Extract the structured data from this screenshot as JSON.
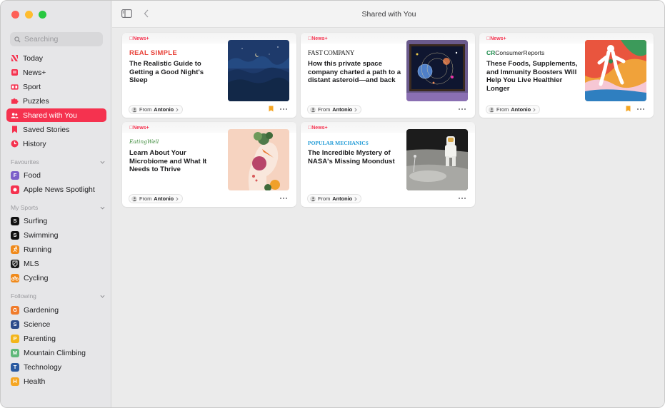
{
  "window": {
    "title": "Shared with You"
  },
  "search": {
    "placeholder": "Searching"
  },
  "nav": [
    {
      "label": "Today",
      "icon": "news-n-icon"
    },
    {
      "label": "News+",
      "icon": "news-plus-icon"
    },
    {
      "label": "Sport",
      "icon": "scoreboard-icon"
    },
    {
      "label": "Puzzles",
      "icon": "puzzle-icon"
    },
    {
      "label": "Shared with You",
      "icon": "people-icon",
      "active": true
    },
    {
      "label": "Saved Stories",
      "icon": "bookmark-icon"
    },
    {
      "label": "History",
      "icon": "clock-icon"
    }
  ],
  "favourites": {
    "header": "Favourites",
    "items": [
      {
        "label": "Food",
        "badge": "F",
        "color": "#7b5fc9"
      },
      {
        "label": "Apple News Spotlight",
        "badge": "",
        "color": "#f5324f"
      }
    ]
  },
  "my_sports": {
    "header": "My Sports",
    "items": [
      {
        "label": "Surfing",
        "badge": "S",
        "color": "#111111"
      },
      {
        "label": "Swimming",
        "badge": "S",
        "color": "#111111"
      },
      {
        "label": "Running",
        "badge": "",
        "color": "#f08a1c"
      },
      {
        "label": "MLS",
        "badge": "",
        "color": "#1a1a1a"
      },
      {
        "label": "Cycling",
        "badge": "",
        "color": "#f08a1c"
      }
    ]
  },
  "following": {
    "header": "Following",
    "items": [
      {
        "label": "Gardening",
        "badge": "G",
        "color": "#f07b2a"
      },
      {
        "label": "Science",
        "badge": "S",
        "color": "#2c4a8a"
      },
      {
        "label": "Parenting",
        "badge": "P",
        "color": "#f3b51b"
      },
      {
        "label": "Mountain Climbing",
        "badge": "M",
        "color": "#5fb87a"
      },
      {
        "label": "Technology",
        "badge": "T",
        "color": "#2a5aa0"
      },
      {
        "label": "Health",
        "badge": "H",
        "color": "#f5a623"
      }
    ]
  },
  "cards": [
    {
      "tag": "News+",
      "publisher": "REAL SIMPLE",
      "headline": "The Realistic Guide to Getting a Good Night's Sleep",
      "from_prefix": "From",
      "from_name": "Antonio",
      "bookmarked": true
    },
    {
      "tag": "News+",
      "publisher": "FAST COMPANY",
      "headline": "How this private space company charted a path to a distant asteroid—and back",
      "from_prefix": "From",
      "from_name": "Antonio",
      "bookmarked": false
    },
    {
      "tag": "News+",
      "publisher": "ConsumerReports",
      "publisher_mark": "CR",
      "headline": "These Foods, Supplements, and Immunity Boosters Will Help You Live Healthier Longer",
      "from_prefix": "From",
      "from_name": "Antonio",
      "bookmarked": true
    },
    {
      "tag": "News+",
      "publisher": "EatingWell",
      "headline": "Learn About Your Microbiome and What It Needs to Thrive",
      "from_prefix": "From",
      "from_name": "Antonio",
      "bookmarked": false
    },
    {
      "tag": "News+",
      "publisher": "POPULAR MECHANICS",
      "headline": "The Incredible Mystery of NASA's Missing Moondust",
      "from_prefix": "From",
      "from_name": "Antonio",
      "bookmarked": false
    }
  ],
  "colors": {
    "accent": "#f5324f",
    "bookmark": "#f5a623"
  }
}
